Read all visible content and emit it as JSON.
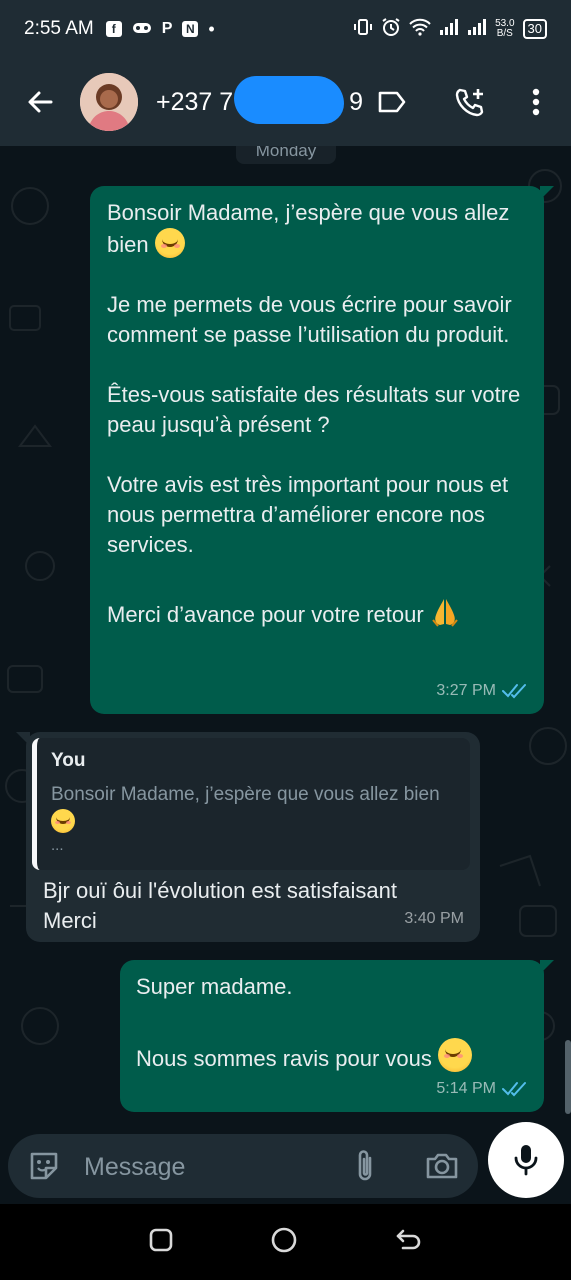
{
  "status_bar": {
    "time": "2:55 AM",
    "notif_icons": [
      "facebook-icon",
      "gamepad-icon",
      "p-icon",
      "n-icon",
      "dot-icon"
    ],
    "net_speed_value": "53.0",
    "net_speed_unit": "B/S",
    "battery": "30"
  },
  "header": {
    "contact_name": "+237 7",
    "contact_name_tail": "9",
    "icons": [
      "back-arrow-icon",
      "label-icon",
      "call-add-icon",
      "more-vert-icon"
    ]
  },
  "chat": {
    "day_label": "Monday",
    "messages": [
      {
        "direction": "outgoing",
        "paragraphs": [
          "Bonsoir Madame, j’espère que vous allez bien",
          "Je me permets de vous écrire pour savoir comment se passe l’utilisation du produit.",
          "Êtes-vous satisfaite des résultats sur votre peau jusqu’à présent ?",
          "Votre avis est très important pour nous et nous permettra d’améliorer encore nos services.",
          "Merci d’avance pour votre retour"
        ],
        "time": "3:27 PM",
        "status": "read"
      },
      {
        "direction": "incoming",
        "quote": {
          "author": "You",
          "text": "Bonsoir Madame, j’espère que vous allez bien",
          "ellipsis": "..."
        },
        "text_line1": "Bjr ouï ôui l'évolution est satisfaisant",
        "text_line2": "Merci",
        "time": "3:40 PM"
      },
      {
        "direction": "outgoing",
        "paragraphs": [
          "Super madame.",
          "Nous sommes ravis pour vous"
        ],
        "time": "5:14 PM",
        "status": "read"
      }
    ]
  },
  "composer": {
    "placeholder": "Message",
    "icons": [
      "sticker-icon",
      "attach-icon",
      "camera-icon",
      "mic-icon"
    ]
  },
  "nav_bar": {
    "icons": [
      "recents-icon",
      "home-icon",
      "back-icon"
    ]
  },
  "colors": {
    "outgoing_bubble": "#005c4b",
    "incoming_bubble": "#202c33",
    "background": "#0b141a",
    "header": "#1f2c34",
    "read_ticks": "#53bdeb"
  }
}
